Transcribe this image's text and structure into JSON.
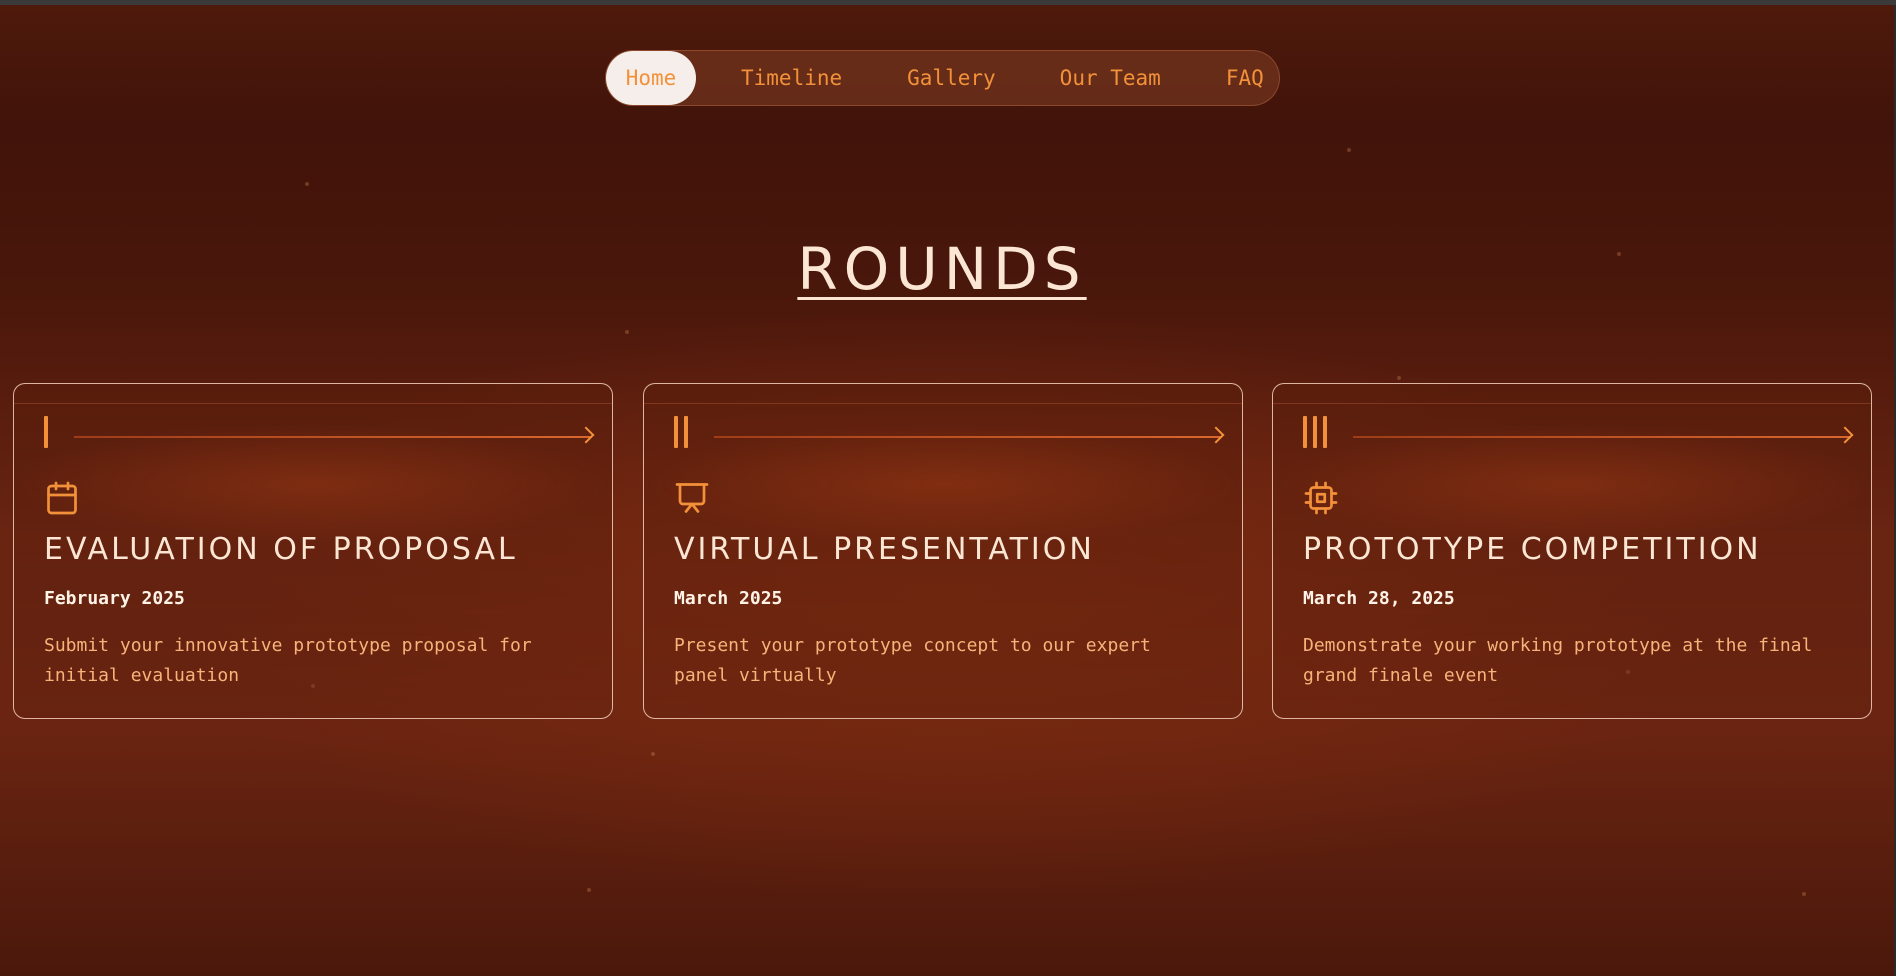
{
  "nav": {
    "items": [
      {
        "label": "Home",
        "active": true
      },
      {
        "label": "Timeline",
        "active": false
      },
      {
        "label": "Gallery",
        "active": false
      },
      {
        "label": "Our Team",
        "active": false
      },
      {
        "label": "FAQ",
        "active": false
      }
    ]
  },
  "section": {
    "title": "ROUNDS"
  },
  "rounds": [
    {
      "numeral": "I",
      "icon": "calendar-icon",
      "title": "EVALUATION OF PROPOSAL",
      "date": "February 2025",
      "description": "Submit your innovative prototype proposal for initial evaluation"
    },
    {
      "numeral": "II",
      "icon": "presentation-board-icon",
      "title": "VIRTUAL PRESENTATION",
      "date": "March 2025",
      "description": "Present your prototype concept to our expert panel virtually"
    },
    {
      "numeral": "III",
      "icon": "cpu-chip-icon",
      "title": "PROTOTYPE COMPETITION",
      "date": "March 28, 2025",
      "description": "Demonstrate your working prototype at the final grand finale event"
    }
  ],
  "colors": {
    "accent": "#f3913a",
    "title_text": "#fbe6d4",
    "description_text": "#f7b37a",
    "background_dark": "#41130a",
    "background_mid": "#6a2412",
    "nav_active_bg": "#f6eeea"
  }
}
